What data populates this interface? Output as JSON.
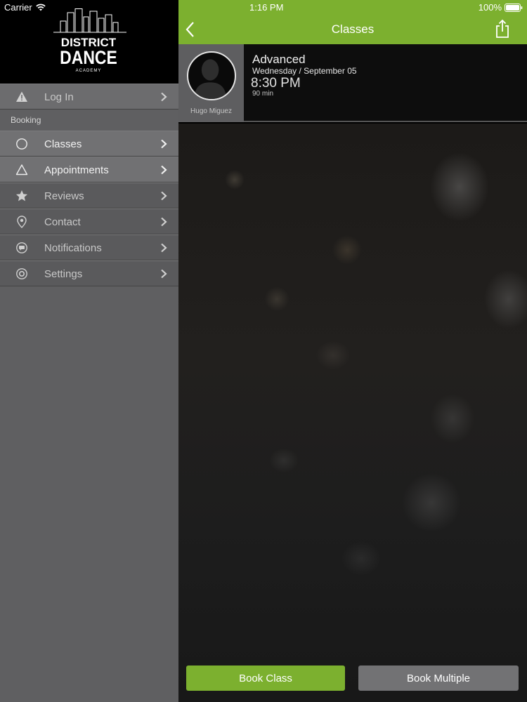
{
  "status_bar": {
    "carrier": "Carrier",
    "time": "1:16 PM",
    "battery": "100%"
  },
  "brand": {
    "line1": "DISTRICT",
    "line2": "DANCE",
    "line3": "ACADEMY"
  },
  "sidebar": {
    "top_item": {
      "label": "Log In",
      "icon": "warning-icon"
    },
    "section_label": "Booking",
    "items": [
      {
        "label": "Classes",
        "icon": "circle-icon"
      },
      {
        "label": "Appointments",
        "icon": "triangle-icon"
      },
      {
        "label": "Reviews",
        "icon": "star-icon"
      },
      {
        "label": "Contact",
        "icon": "location-pin-icon"
      },
      {
        "label": "Notifications",
        "icon": "chat-bubble-icon"
      },
      {
        "label": "Settings",
        "icon": "gear-icon"
      }
    ]
  },
  "header": {
    "title": "Classes"
  },
  "class_detail": {
    "instructor": "Hugo Miguez",
    "name": "Advanced",
    "date": "Wednesday / September 05",
    "time": "8:30 PM",
    "duration": "90 min"
  },
  "actions": {
    "book_class": "Book Class",
    "book_multiple": "Book Multiple"
  },
  "colors": {
    "accent": "#7cb02f",
    "sidebar_bg": "#5f5f61",
    "secondary_button": "#727274"
  }
}
